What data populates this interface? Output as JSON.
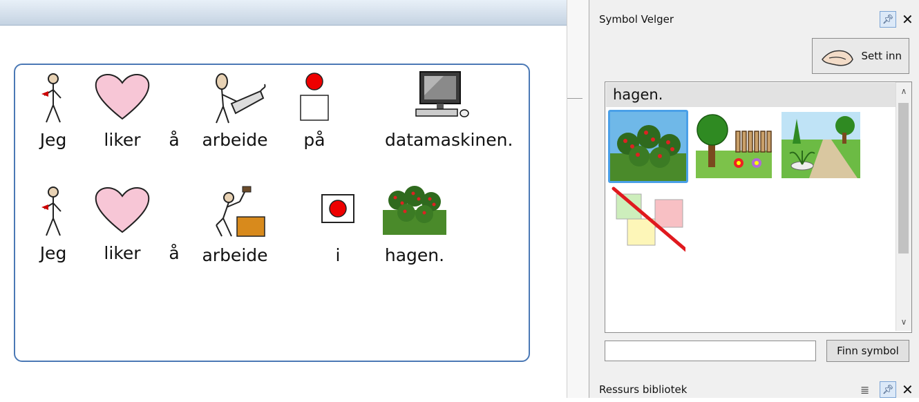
{
  "document": {
    "rows": [
      {
        "cells": [
          {
            "word": "Jeg",
            "icon": "person-pointing-self-icon"
          },
          {
            "word": "liker",
            "icon": "heart-icon"
          },
          {
            "word": "å",
            "icon": ""
          },
          {
            "word": "arbeide",
            "icon": "person-typing-keyboard-icon"
          },
          {
            "word": "på",
            "icon": "on-top-symbol-icon"
          },
          {
            "word": "datamaskinen.",
            "icon": "desktop-computer-icon"
          }
        ]
      },
      {
        "cells": [
          {
            "word": "Jeg",
            "icon": "person-pointing-self-icon"
          },
          {
            "word": "liker",
            "icon": "heart-icon"
          },
          {
            "word": "å",
            "icon": ""
          },
          {
            "word": "arbeide",
            "icon": "person-hammering-icon"
          },
          {
            "word": "i",
            "icon": "in-symbol-icon"
          },
          {
            "word": "hagen.",
            "icon": "garden-trees-icon"
          }
        ]
      }
    ]
  },
  "symbol_panel": {
    "title": "Symbol Velger",
    "pin_icon": "pin-icon",
    "close_icon": "close-icon",
    "insert_button": {
      "label": "Sett inn",
      "icon": "hand-insert-icon"
    },
    "results_header": "hagen.",
    "results": [
      {
        "icon": "orchard-trees-icon",
        "selected": true
      },
      {
        "icon": "garden-fence-flowers-icon",
        "selected": false
      },
      {
        "icon": "park-fountain-icon",
        "selected": false
      },
      {
        "icon": "no-symbol-icon",
        "selected": false
      }
    ],
    "search": {
      "value": "",
      "placeholder": ""
    },
    "find_button": "Finn symbol"
  },
  "resource_panel": {
    "title": "Ressurs bibliotek",
    "list_icon": "list-view-icon",
    "pin_icon": "pin-icon",
    "close_icon": "close-icon"
  },
  "colors": {
    "accent": "#4a78b5",
    "selection": "#4aa0e8",
    "panel_bg": "#f0f0f0"
  }
}
